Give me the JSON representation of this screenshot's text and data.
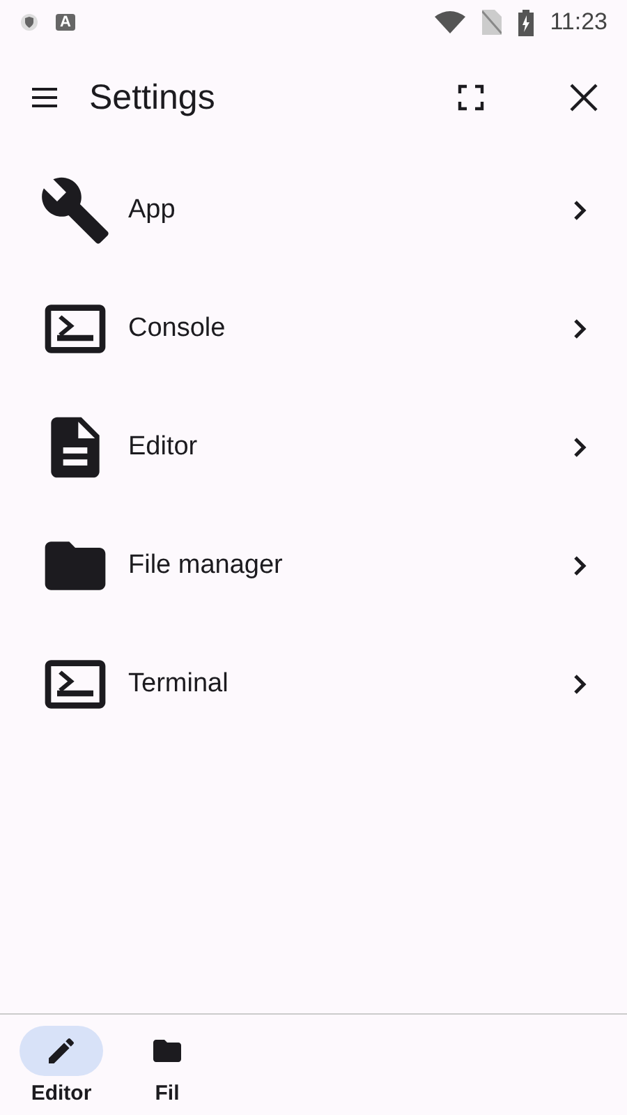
{
  "status_bar": {
    "notification_label": "A",
    "time": "11:23"
  },
  "app_bar": {
    "title": "Settings"
  },
  "items": [
    {
      "label": "App",
      "kind": "wrench"
    },
    {
      "label": "Console",
      "kind": "terminal"
    },
    {
      "label": "Editor",
      "kind": "document"
    },
    {
      "label": "File manager",
      "kind": "folder"
    },
    {
      "label": "Terminal",
      "kind": "terminal"
    }
  ],
  "bottom_nav": [
    {
      "label": "Editor",
      "kind": "pencil",
      "selected": true
    },
    {
      "label": "Fil",
      "kind": "folder",
      "selected": false
    }
  ]
}
